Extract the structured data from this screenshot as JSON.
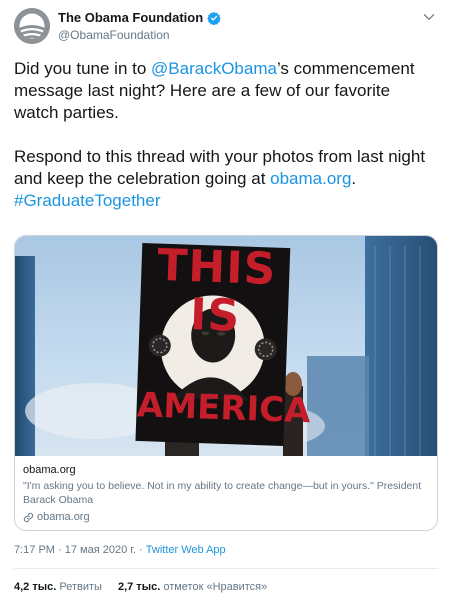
{
  "author": {
    "display_name": "The Obama Foundation",
    "handle": "@ObamaFoundation",
    "verified": true
  },
  "body": {
    "p1_part1": "Did you tune in to ",
    "p1_mention": "@BarackObama",
    "p1_part2": "’s commencement message last night? Here are a few of our favorite watch parties.",
    "p2_part1": "Respond to this thread with your photos from last night and keep the celebration going at ",
    "p2_link": "obama.org",
    "p2_part2": ".",
    "hashtag": "#GraduateTogether"
  },
  "card": {
    "sign_top": "THIS IS",
    "sign_bottom": "AMERICA",
    "domain": "obama.org",
    "description": "\"I'm asking you to believe. Not in my ability to create change—but in yours.\" President Barack Obama",
    "link_text": "obama.org"
  },
  "meta": {
    "time": "7:17 PM",
    "sep1": " · ",
    "date": "17 мая 2020 г.",
    "sep2": " · ",
    "source": "Twitter Web App"
  },
  "stats": {
    "retweets_count": "4,2 тыс.",
    "retweets_label": "Ретвиты",
    "likes_count": "2,7 тыс.",
    "likes_label": "отметок «Нравится»"
  },
  "colors": {
    "link": "#1b95e0",
    "secondary_text": "#657786",
    "sign_red": "#c41e2a"
  },
  "icons": [
    "verified-badge-icon",
    "chevron-down-icon",
    "link-icon"
  ]
}
